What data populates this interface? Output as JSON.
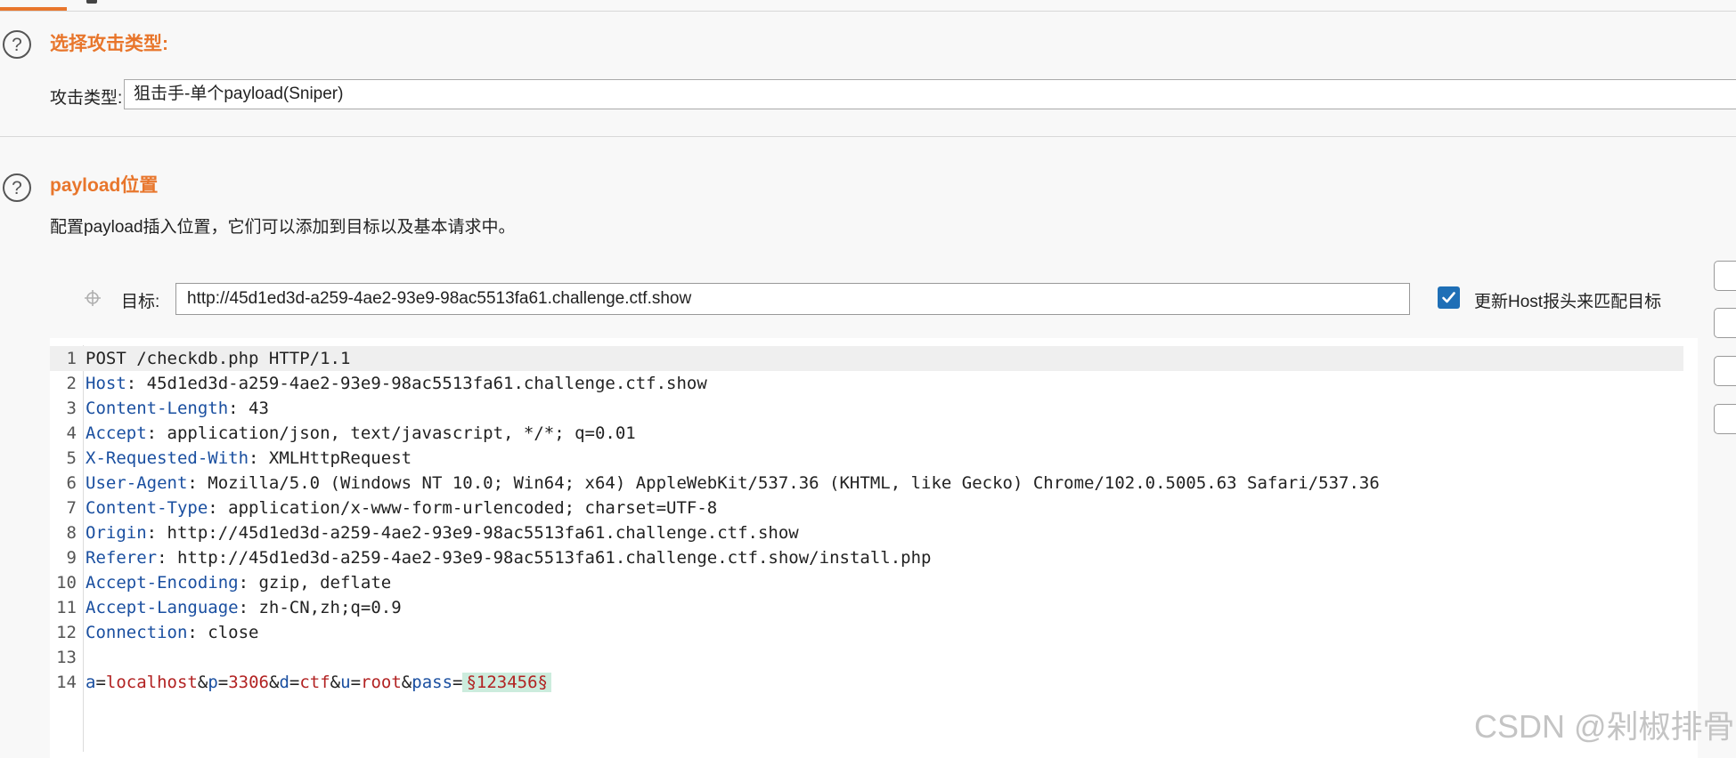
{
  "attack_type_section": {
    "title": "选择攻击类型:",
    "label": "攻击类型:",
    "selected": "狙击手-单个payload(Sniper)"
  },
  "positions_section": {
    "title": "payload位置",
    "description": "配置payload插入位置，它们可以添加到目标以及基本请求中。"
  },
  "target": {
    "label": "目标:",
    "value": "http://45d1ed3d-a259-4ae2-93e9-98ac5513fa61.challenge.ctf.show",
    "update_host_checked": true,
    "update_host_label": "更新Host报头来匹配目标"
  },
  "request": {
    "request_line": "POST /checkdb.php HTTP/1.1",
    "headers": [
      {
        "name": "Host",
        "value": "45d1ed3d-a259-4ae2-93e9-98ac5513fa61.challenge.ctf.show"
      },
      {
        "name": "Content-Length",
        "value": "43"
      },
      {
        "name": "Accept",
        "value": "application/json, text/javascript, */*; q=0.01"
      },
      {
        "name": "X-Requested-With",
        "value": "XMLHttpRequest"
      },
      {
        "name": "User-Agent",
        "value": "Mozilla/5.0 (Windows NT 10.0; Win64; x64) AppleWebKit/537.36 (KHTML, like Gecko) Chrome/102.0.5005.63 Safari/537.36"
      },
      {
        "name": "Content-Type",
        "value": "application/x-www-form-urlencoded; charset=UTF-8"
      },
      {
        "name": "Origin",
        "value": "http://45d1ed3d-a259-4ae2-93e9-98ac5513fa61.challenge.ctf.show"
      },
      {
        "name": "Referer",
        "value": "http://45d1ed3d-a259-4ae2-93e9-98ac5513fa61.challenge.ctf.show/install.php"
      },
      {
        "name": "Accept-Encoding",
        "value": "gzip, deflate"
      },
      {
        "name": "Accept-Language",
        "value": "zh-CN,zh;q=0.9"
      },
      {
        "name": "Connection",
        "value": "close"
      }
    ],
    "body_params": [
      {
        "key": "a",
        "value": "localhost"
      },
      {
        "key": "p",
        "value": "3306"
      },
      {
        "key": "d",
        "value": "ctf"
      },
      {
        "key": "u",
        "value": "root"
      },
      {
        "key": "pass",
        "value": "§123456§",
        "marked": true
      }
    ]
  },
  "watermark": "CSDN @剁椒排骨",
  "colors": {
    "accent": "#e8762c",
    "checkbox": "#1e6fb6",
    "payload_marker_bg": "#ccecdd"
  },
  "icons": [
    "help-icon",
    "crosshair-icon",
    "checkmark-icon"
  ]
}
